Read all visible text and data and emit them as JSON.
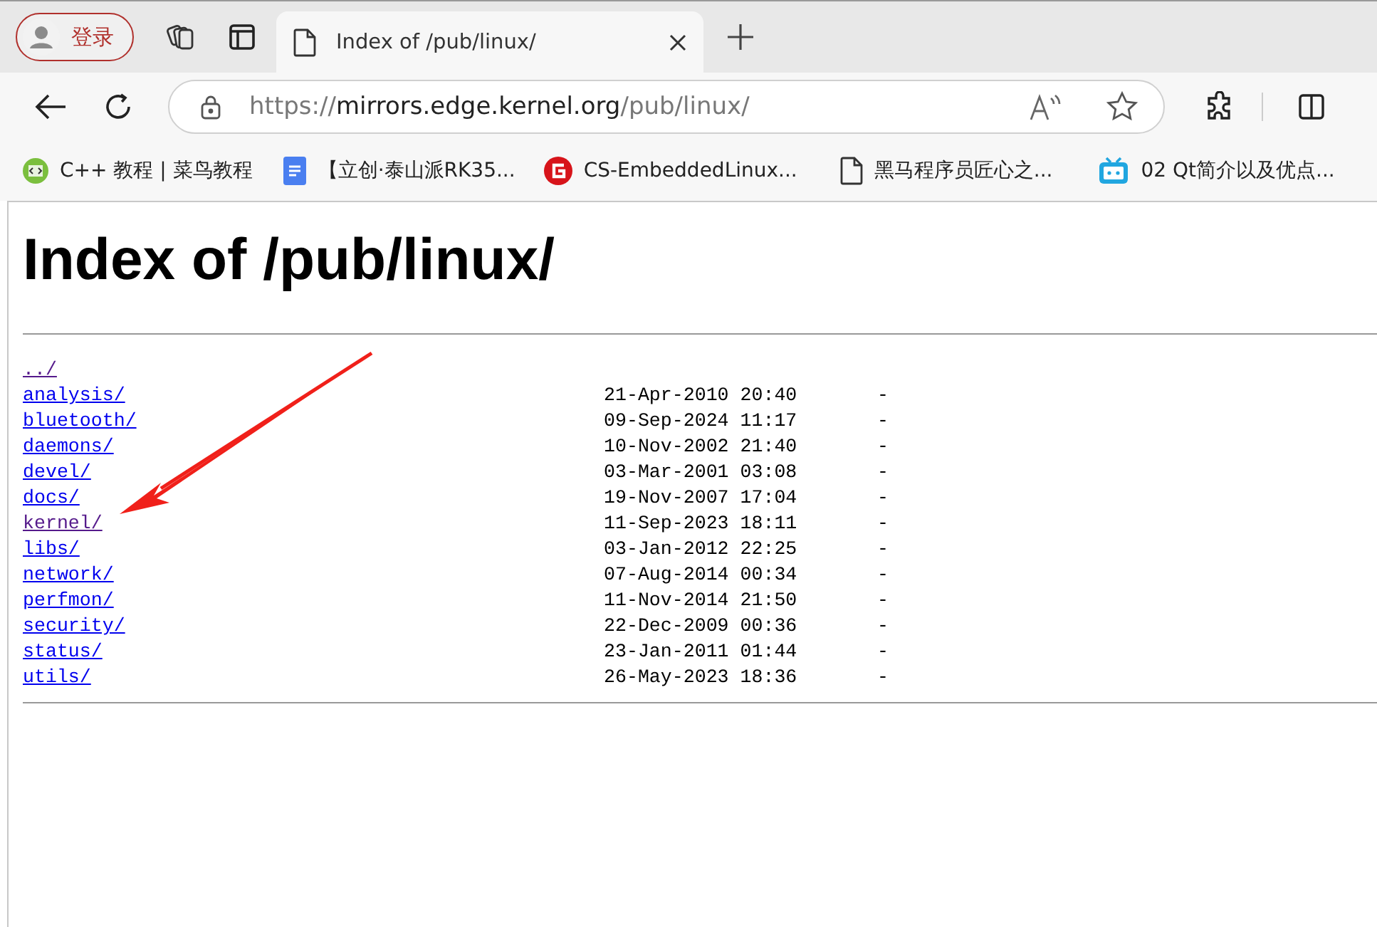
{
  "browser": {
    "profile_label": "登录",
    "tabs": [
      {
        "title": "Index of /pub/linux/",
        "selected": true
      }
    ],
    "address": {
      "scheme": "https://",
      "host": "mirrors.edge.kernel.org",
      "path": "/pub/linux/"
    },
    "bookmarks": [
      {
        "label": "C++ 教程 | 菜鸟教程"
      },
      {
        "label": "【立创·泰山派RK35..."
      },
      {
        "label": "CS-EmbeddedLinux..."
      },
      {
        "label": "黑马程序员匠心之..."
      },
      {
        "label": "02 Qt简介以及优点..."
      }
    ]
  },
  "page": {
    "heading": "Index of /pub/linux/",
    "entries": [
      {
        "name": "../",
        "visited": true
      },
      {
        "name": "analysis/",
        "date": "21-Apr-2010 20:40",
        "size": "-",
        "visited": false
      },
      {
        "name": "bluetooth/",
        "date": "09-Sep-2024 11:17",
        "size": "-",
        "visited": false
      },
      {
        "name": "daemons/",
        "date": "10-Nov-2002 21:40",
        "size": "-",
        "visited": false
      },
      {
        "name": "devel/",
        "date": "03-Mar-2001 03:08",
        "size": "-",
        "visited": false
      },
      {
        "name": "docs/",
        "date": "19-Nov-2007 17:04",
        "size": "-",
        "visited": false
      },
      {
        "name": "kernel/",
        "date": "11-Sep-2023 18:11",
        "size": "-",
        "visited": true
      },
      {
        "name": "libs/",
        "date": "03-Jan-2012 22:25",
        "size": "-",
        "visited": false
      },
      {
        "name": "network/",
        "date": "07-Aug-2014 00:34",
        "size": "-",
        "visited": false
      },
      {
        "name": "perfmon/",
        "date": "11-Nov-2014 21:50",
        "size": "-",
        "visited": false
      },
      {
        "name": "security/",
        "date": "22-Dec-2009 00:36",
        "size": "-",
        "visited": false
      },
      {
        "name": "status/",
        "date": "23-Jan-2011 01:44",
        "size": "-",
        "visited": false
      },
      {
        "name": "utils/",
        "date": "26-May-2023 18:36",
        "size": "-",
        "visited": false
      }
    ]
  }
}
